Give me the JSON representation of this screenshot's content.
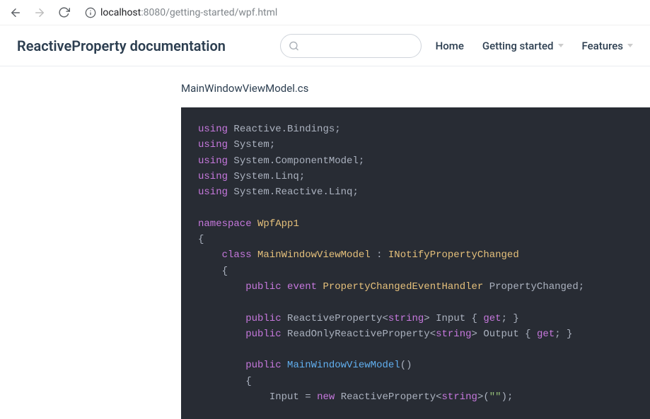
{
  "browser": {
    "url_host": "localhost",
    "url_port": ":8080",
    "url_path": "/getting-started/wpf.html"
  },
  "header": {
    "site_title": "ReactiveProperty documentation",
    "search_placeholder": "",
    "nav": {
      "home": "Home",
      "getting_started": "Getting started",
      "features": "Features"
    }
  },
  "content": {
    "file_label": "MainWindowViewModel.cs"
  },
  "code": {
    "kw_using": "using",
    "ns_reactive_bindings": "Reactive.Bindings",
    "ns_system": "System",
    "ns_componentmodel": "System.ComponentModel",
    "ns_linq": "System.Linq",
    "ns_reactive_linq": "System.Reactive.Linq",
    "kw_namespace": "namespace",
    "ns_app": "WpfApp1",
    "kw_class": "class",
    "cls_vm": "MainWindowViewModel",
    "iface": "INotifyPropertyChanged",
    "kw_public": "public",
    "kw_event": "event",
    "type_pceh": "PropertyChangedEventHandler",
    "prop_pc": "PropertyChanged",
    "type_rp": "ReactiveProperty",
    "type_rorp": "ReadOnlyReactiveProperty",
    "builtin_string": "string",
    "prop_input": "Input",
    "prop_output": "Output",
    "kw_get": "get",
    "ctor": "MainWindowViewModel",
    "assign_input": "Input",
    "kw_new": "new",
    "str_empty": "\"\"",
    "semi": ";",
    "colon": ":",
    "lt": "<",
    "gt": ">",
    "lbrace": "{",
    "rbrace": "}",
    "lparen": "(",
    "rparen": ")",
    "eq": "="
  }
}
